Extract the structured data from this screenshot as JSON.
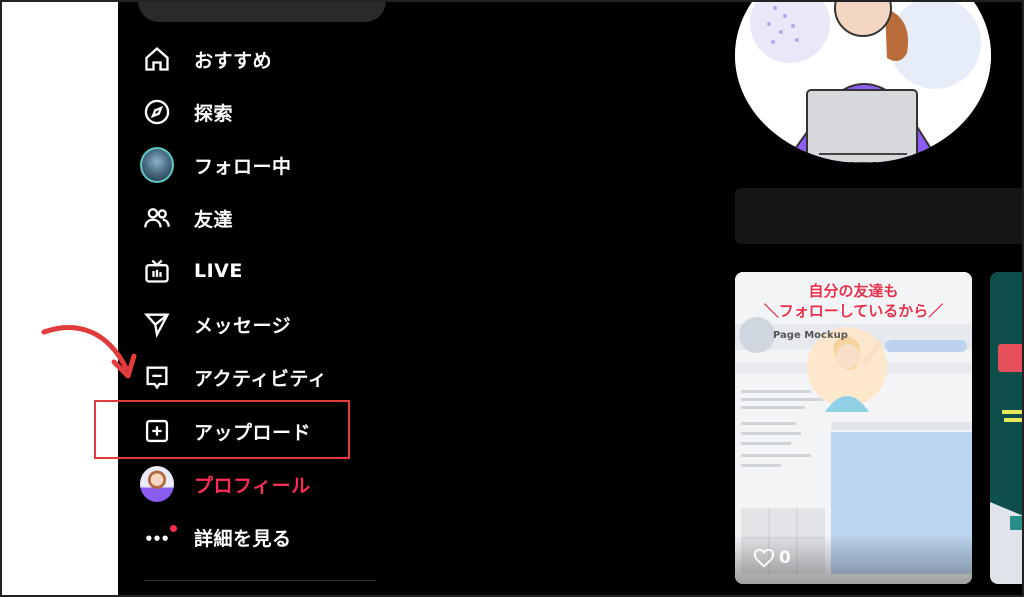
{
  "nav": {
    "items": [
      {
        "label": "おすすめ",
        "icon": "home-icon"
      },
      {
        "label": "探索",
        "icon": "compass-icon"
      },
      {
        "label": "フォロー中",
        "icon": "following-avatar"
      },
      {
        "label": "友達",
        "icon": "friends-icon"
      },
      {
        "label": "LIVE",
        "icon": "live-tv-icon"
      },
      {
        "label": "メッセージ",
        "icon": "send-icon"
      },
      {
        "label": "アクティビティ",
        "icon": "activity-icon"
      },
      {
        "label": "アップロード",
        "icon": "upload-plus-icon"
      },
      {
        "label": "プロフィール",
        "icon": "profile-avatar"
      },
      {
        "label": "詳細を見る",
        "icon": "more-icon"
      }
    ],
    "active_index": 8
  },
  "feed": {
    "card1": {
      "overlay_line1": "自分の友達も",
      "overlay_line2": "＼フォローしているから／",
      "mock_title": "Page Mockup",
      "likes": "0"
    }
  },
  "colors": {
    "accent": "#fe2c55",
    "highlight": "#e23b3b",
    "background": "#000000"
  }
}
